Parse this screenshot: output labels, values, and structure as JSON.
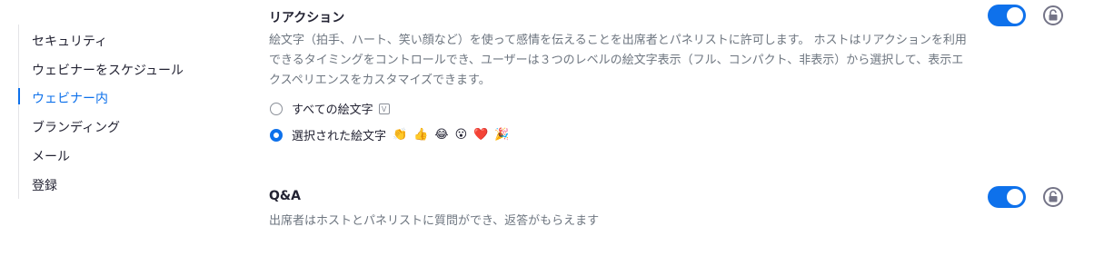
{
  "sidebar": {
    "items": [
      {
        "label": "セキュリティ"
      },
      {
        "label": "ウェビナーをスケジュール"
      },
      {
        "label": "ウェビナー内",
        "active": true
      },
      {
        "label": "ブランディング"
      },
      {
        "label": "メール"
      },
      {
        "label": "登録"
      }
    ]
  },
  "reactions": {
    "title": "リアクション",
    "description": "絵文字（拍手、ハート、笑い顔など）を使って感情を伝えることを出席者とパネリストに許可します。 ホストはリアクションを利用できるタイミングをコントロールでき、ユーザーは３つのレベルの絵文字表示（フル、コンパクト、非表示）から選択して、表示エクスペリエンスをカスタマイズできます。",
    "enabled": true,
    "options": [
      {
        "label": "すべての絵文字",
        "selected": false,
        "badge": "V"
      },
      {
        "label": "選択された絵文字",
        "selected": true
      }
    ],
    "emojis": [
      "👏",
      "👍",
      "😂",
      "😮",
      "❤️",
      "🎉"
    ]
  },
  "qa": {
    "title": "Q&A",
    "description": "出席者はホストとパネリストに質問ができ、返答がもらえます",
    "enabled": true
  },
  "colors": {
    "accent": "#0e71eb",
    "text": "#232333",
    "muted": "#6e7680"
  }
}
